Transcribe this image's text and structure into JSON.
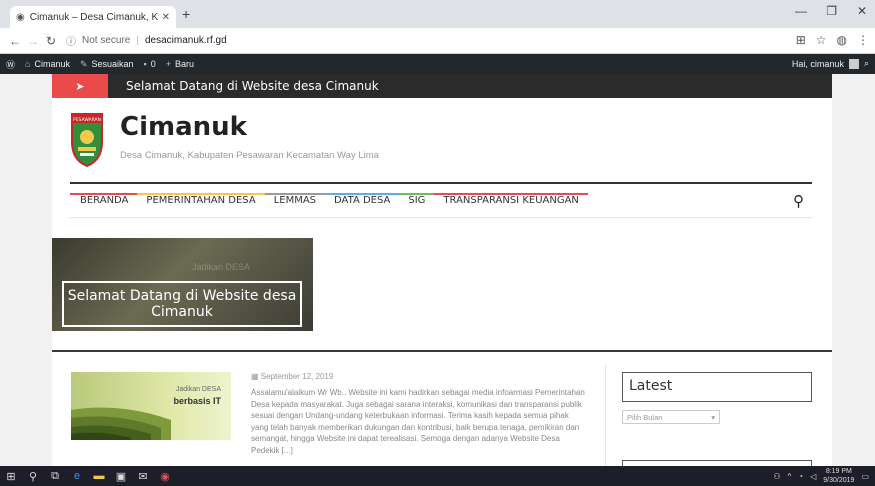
{
  "browser": {
    "tab_title": "Cimanuk – Desa Cimanuk, Kabup",
    "new_tab": "+",
    "security": "Not secure",
    "url": "desacimanuk.rf.gd"
  },
  "adminbar": {
    "site": "Cimanuk",
    "customize": "Sesuaikan",
    "comments": "0",
    "new": "Baru",
    "greeting": "Hai, cimanuk"
  },
  "announcement": {
    "text": "Selamat Datang di Website desa Cimanuk"
  },
  "site": {
    "logo_text": "PESAWARAN",
    "title": "Cimanuk",
    "description": "Desa Cimanuk, Kabupaten Pesawaran Kecamatan Way Lima"
  },
  "nav": {
    "items": [
      {
        "label": "BERANDA",
        "accent": "#e94b4b"
      },
      {
        "label": "PEMERINTAHAN DESA",
        "accent": "#f2c94c"
      },
      {
        "label": "LEMMAS",
        "accent": "#9b9b9b"
      },
      {
        "label": "DATA DESA",
        "accent": "#5db0d3"
      },
      {
        "label": "SIG",
        "accent": "#6bbf59"
      },
      {
        "label": "TRANSPARANSI KEUANGAN",
        "accent": "#e94b4b"
      }
    ]
  },
  "slider": {
    "caption_line1": "Selamat Datang di Website desa",
    "caption_line2": "Cimanuk",
    "ghost": "Jadikan DESA"
  },
  "post": {
    "thumb_line1": "Jadikan DESA",
    "thumb_line2": "berbasis IT",
    "date": "September 12, 2019",
    "excerpt": "Assalamu'alaikum Wr Wb.. Website ini kami hadirkan sebagai media infoarmasi Pemerintahan Desa kepada masyarakat. Juga sebagai sarana interaksi, komunikasi dan transparansi publik sesuai dengan Undang-undang keterbukaan informasi. Terima kasih kepada semua pihak yang telah banyak memberikan dukungan dan kontribusi, baik berupa tenaga, pemikiran dan semangat, hingga Website ini dapat terealisasi. Semoga dengan adanya Website Desa Pedekik [...]"
  },
  "sidebar": {
    "latest_title": "Latest",
    "month_select": "Pilih Bulan"
  },
  "taskbar": {
    "time": "8:19 PM",
    "date": "9/30/2019"
  }
}
